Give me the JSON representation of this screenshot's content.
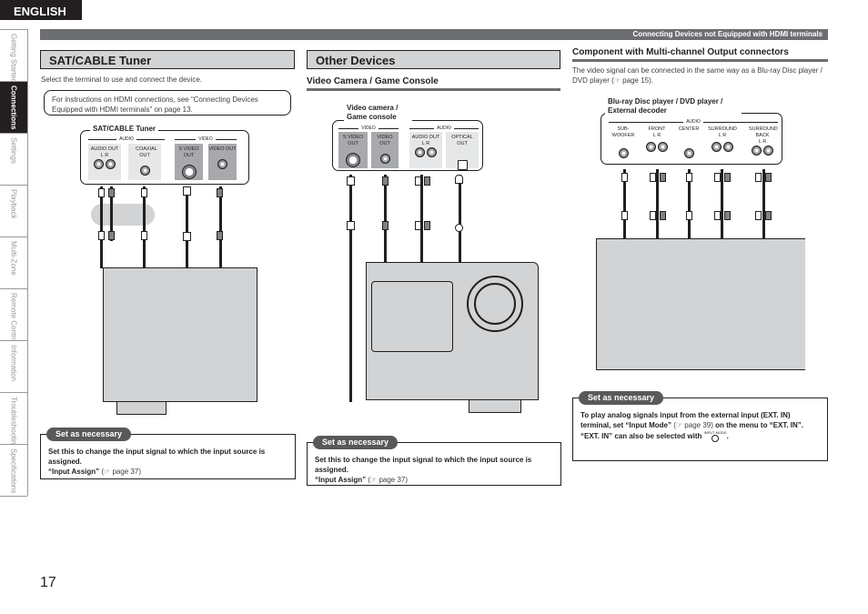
{
  "language_tab": "ENGLISH",
  "header_bar": "Connecting Devices not Equipped with HDMI terminals",
  "side_nav": [
    {
      "label": "Getting Started",
      "active": false
    },
    {
      "label": "Connections",
      "active": true
    },
    {
      "label": "Settings",
      "active": false
    },
    {
      "label": "Playback",
      "active": false
    },
    {
      "label": "Multi-Zone",
      "active": false
    },
    {
      "label": "Remote Control",
      "active": false
    },
    {
      "label": "Information",
      "active": false
    },
    {
      "label": "Troubleshooting",
      "active": false
    },
    {
      "label": "Specifications",
      "active": false
    }
  ],
  "sat_cable": {
    "title": "SAT/CABLE Tuner",
    "intro": "Select the terminal to use and connect the device.",
    "note": "For instructions on HDMI connections, see “Connecting Devices Equipped with HDMI terminals” on page 13.",
    "device_label": "SAT/CABLE Tuner",
    "groups": {
      "audio": "AUDIO",
      "video": "VIDEO"
    },
    "terminals": [
      {
        "label": "AUDIO OUT",
        "channels": "L    R"
      },
      {
        "label": "COAXIAL OUT"
      },
      {
        "label": "S VIDEO OUT"
      },
      {
        "label": "VIDEO OUT"
      }
    ],
    "set_as_necessary": {
      "pill": "Set as necessary",
      "text": "Set this to change the input signal to which the input source is assigned.",
      "ref_bold": "“Input Assign”",
      "ref_page": "(☞ page 37)"
    }
  },
  "other_devices": {
    "title": "Other Devices",
    "subtitle": "Video Camera / Game Console",
    "device_label": "Video camera / Game console",
    "groups": {
      "video": "VIDEO",
      "audio": "AUDIO"
    },
    "terminals": [
      {
        "label": "S VIDEO OUT"
      },
      {
        "label": "VIDEO OUT"
      },
      {
        "label": "AUDIO OUT",
        "channels": "L    R"
      },
      {
        "label": "OPTICAL OUT"
      }
    ],
    "set_as_necessary": {
      "pill": "Set as necessary",
      "text": "Set this to change the input signal to which the input source is assigned.",
      "ref_bold": "“Input Assign”",
      "ref_page": "(☞ page 37)"
    }
  },
  "multichannel": {
    "title": "Component with Multi-channel Output connectors",
    "intro": "The video signal can be connected in the same way as a Blu-ray Disc player / DVD player (☞ page 15).",
    "device_label": "Blu-ray Disc player / DVD player / External decoder",
    "group_audio": "AUDIO",
    "terminals": [
      {
        "label": "SUB-WOOFER",
        "channels": ""
      },
      {
        "label": "FRONT",
        "channels": "L    R"
      },
      {
        "label": "CENTER",
        "channels": ""
      },
      {
        "label": "SURROUND",
        "channels": "L    R"
      },
      {
        "label": "SURROUND BACK",
        "channels": "L    R"
      }
    ],
    "set_as_necessary": {
      "pill": "Set as necessary",
      "text1": "To play analog signals input from the external input (EXT. IN) terminal, set “Input Mode”",
      "ref_page": "(☞ page 39)",
      "text2": "on the menu to “EXT. IN”.",
      "text3": "“EXT. IN” can also be selected with",
      "button_label": "INPUT MODE"
    }
  },
  "page_number": "17"
}
